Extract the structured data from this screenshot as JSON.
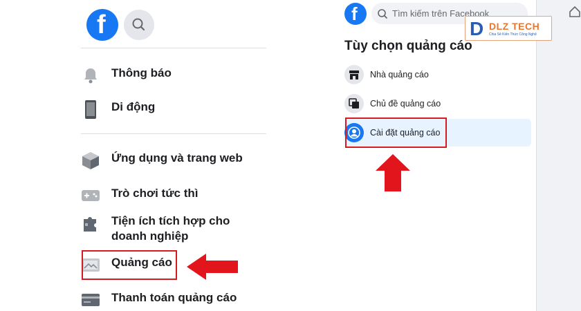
{
  "left_panel": {
    "logo": "f",
    "icons": {
      "search": "search-icon"
    },
    "menu": [
      {
        "label": "Thông báo",
        "icon": "bell-icon"
      },
      {
        "label": "Di động",
        "icon": "mobile-phone-icon"
      },
      {
        "label": "Ứng dụng và trang web",
        "icon": "cube-icon"
      },
      {
        "label": "Trò chơi tức thì",
        "icon": "gamepad-icon"
      },
      {
        "label": "Tiện ích tích hợp cho doanh nghiệp",
        "icon": "puzzle-icon"
      },
      {
        "label": "Quảng cáo",
        "icon": "ads-image-icon"
      },
      {
        "label": "Thanh toán quảng cáo",
        "icon": "credit-card-icon"
      }
    ]
  },
  "right_panel": {
    "logo": "f",
    "search": {
      "placeholder": "Tìm kiếm trên Facebook"
    },
    "title": "Tùy chọn quảng cáo",
    "options": [
      {
        "label": "Nhà quảng cáo",
        "icon": "storefront-icon"
      },
      {
        "label": "Chủ đề quảng cáo",
        "icon": "stacked-cards-icon"
      },
      {
        "label": "Cài đặt quảng cáo",
        "icon": "user-circle-icon"
      }
    ]
  },
  "watermark": {
    "logo_letter": "D",
    "brand": "DLZ TECH",
    "tagline": "Chia Sẻ Kiến Thức Công Nghệ"
  },
  "colors": {
    "facebook_blue": "#1877f2",
    "highlight_red": "#d71920",
    "active_bg": "#e7f3ff"
  }
}
